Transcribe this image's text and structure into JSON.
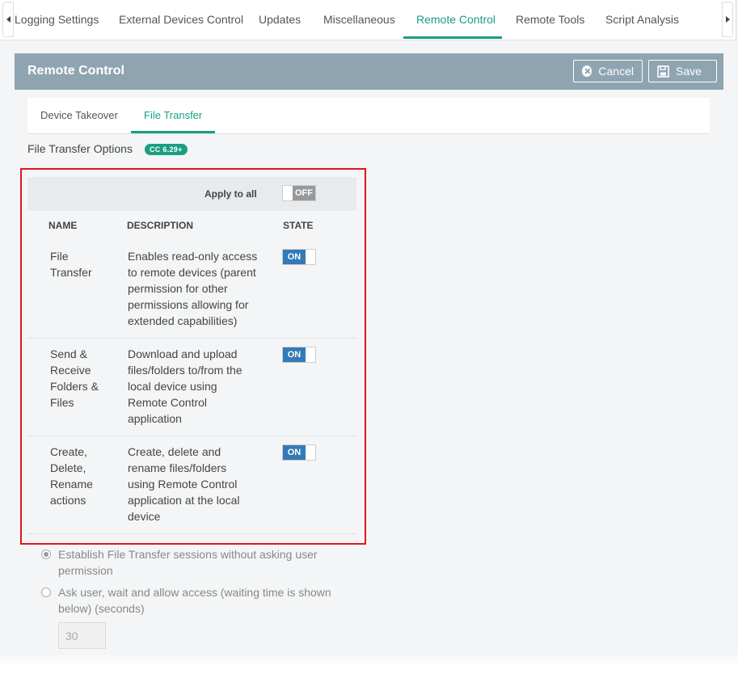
{
  "tabs": {
    "items": [
      "Logging Settings",
      "External Devices Control",
      "Updates",
      "Miscellaneous",
      "Remote Control",
      "Remote Tools",
      "Script Analysis"
    ],
    "active": "Remote Control"
  },
  "panel": {
    "title": "Remote Control",
    "cancel_label": "Cancel",
    "save_label": "Save"
  },
  "subtabs": {
    "items": [
      "Device Takeover",
      "File Transfer"
    ],
    "active": "File Transfer"
  },
  "section": {
    "title": "File Transfer Options",
    "badge": "CC 6.29+"
  },
  "apply_all": {
    "label": "Apply to all",
    "state": "OFF"
  },
  "table": {
    "headers": [
      "NAME",
      "DESCRIPTION",
      "STATE"
    ],
    "rows": [
      {
        "name_lines": [
          "File",
          "Transfer"
        ],
        "desc_lines": [
          "Enables read-only access",
          "to remote devices (parent",
          "permission for other",
          "permissions allowing for",
          "extended capabilities)"
        ],
        "state": "ON"
      },
      {
        "name_lines": [
          "Send &",
          "Receive",
          "Folders &",
          "Files"
        ],
        "desc_lines": [
          "Download and upload",
          "files/folders to/from the",
          "local device using",
          "Remote Control",
          "application"
        ],
        "state": "ON"
      },
      {
        "name_lines": [
          "Create,",
          "Delete,",
          "Rename",
          "actions"
        ],
        "desc_lines": [
          "Create, delete and",
          "rename files/folders",
          "using Remote Control",
          "application at the local",
          "device"
        ],
        "state": "ON"
      }
    ]
  },
  "options": {
    "radio1_lines": [
      "Establish File Transfer sessions without asking user",
      "permission"
    ],
    "radio2_lines": [
      "Ask user, wait and allow access (waiting time is shown",
      "below)  (seconds)"
    ],
    "selected": 1,
    "seconds_value": "30"
  },
  "colors": {
    "accent": "#1a9e82",
    "header_bg": "#8fa4b1",
    "toggle_on": "#337ab7",
    "highlight_box": "#e0161d"
  }
}
